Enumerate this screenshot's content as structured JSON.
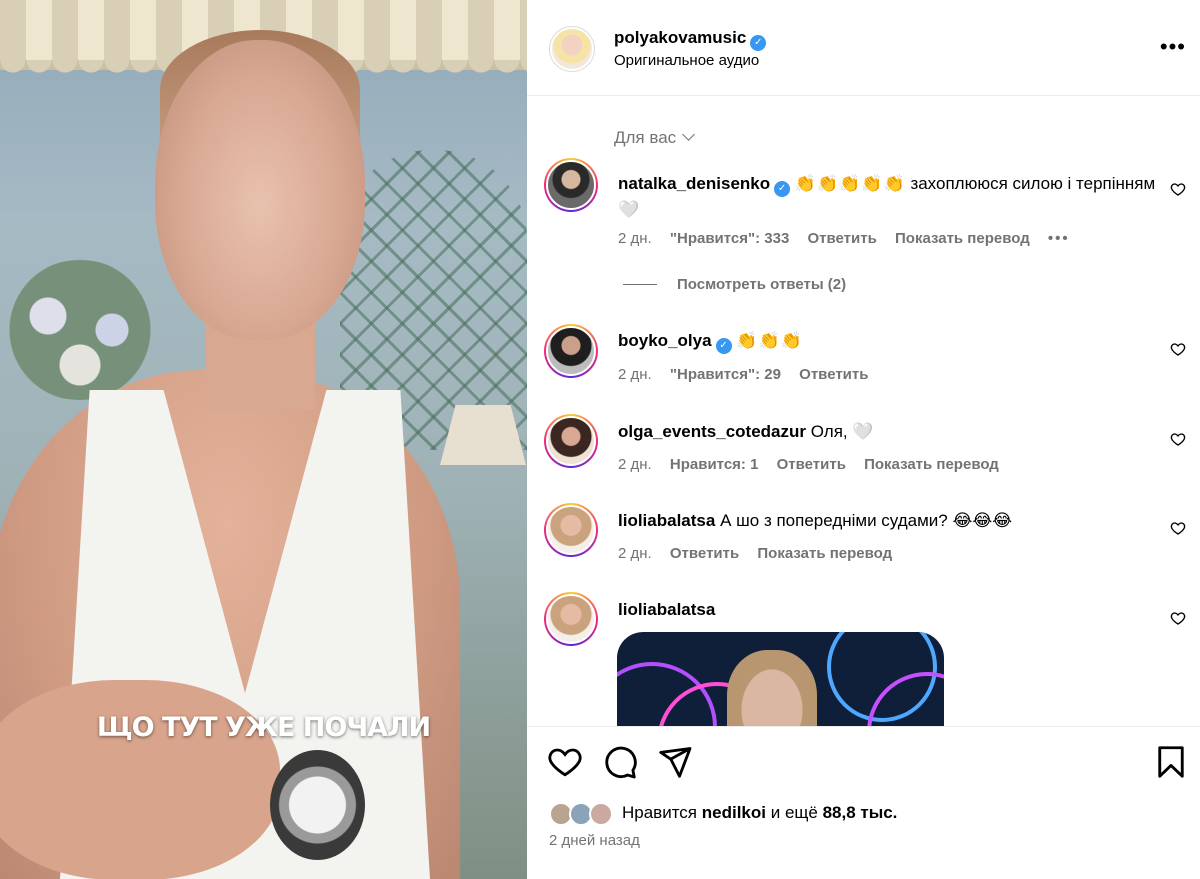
{
  "video": {
    "caption": "ЩО ТУТ УЖЕ ПОЧАЛИ"
  },
  "header": {
    "username": "polyakovamusic",
    "verified": true,
    "audio_label": "Оригинальное аудио",
    "more_icon": "more-horizontal-icon"
  },
  "comments_filter": {
    "label": "Для вас"
  },
  "comments": [
    {
      "username": "natalka_denisenko",
      "verified": true,
      "emoji": "👏👏👏👏👏",
      "text": "захоплююся силою і терпінням 🤍",
      "time": "2 дн.",
      "likes": "\"Нравится\": 333",
      "reply": "Ответить",
      "translate": "Показать перевод",
      "more": "•••"
    },
    {
      "username": "boyko_olya",
      "verified": true,
      "emoji": "👏👏👏",
      "text": "",
      "time": "2 дн.",
      "likes": "\"Нравится\": 29",
      "reply": "Ответить"
    },
    {
      "username": "olga_events_cotedazur",
      "text": "Оля, 🤍",
      "time": "2 дн.",
      "likes": "Нравится: 1",
      "reply": "Ответить",
      "translate": "Показать перевод"
    },
    {
      "username": "lioliabalatsa",
      "text": "А шо з попередніми судами? 😂😂😂",
      "time": "2 дн.",
      "reply": "Ответить",
      "translate": "Показать перевод"
    },
    {
      "username": "lioliabalatsa",
      "text": ""
    }
  ],
  "view_replies": "Посмотреть ответы (2)",
  "actions": {
    "like_icon": "heart-icon",
    "comment_icon": "comment-icon",
    "share_icon": "share-icon",
    "save_icon": "bookmark-icon"
  },
  "likes": {
    "prefix": "Нравится",
    "user": "nedilkoi",
    "suffix": "и ещё",
    "count": "88,8 тыс."
  },
  "post_date": "2 дней назад",
  "colors": {
    "verified": "#3897f0",
    "secondary_text": "#737373",
    "divider": "#ececec"
  }
}
